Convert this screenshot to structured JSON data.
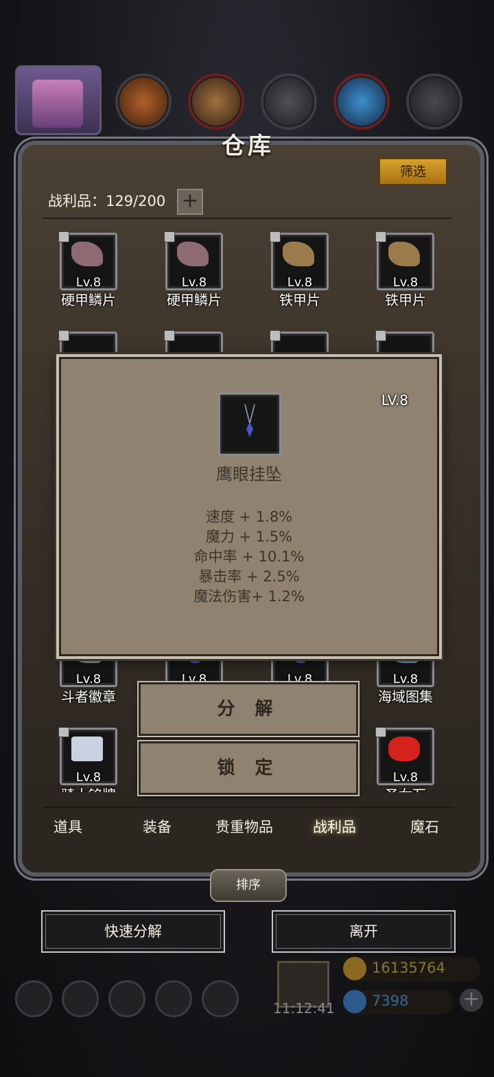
{
  "panel": {
    "title": "仓库",
    "filter_label": "筛选",
    "capacity_label": "战利品：129/200",
    "capacity_plus": "+"
  },
  "items": [
    {
      "lv": "Lv.8",
      "name": "硬甲鳞片",
      "icon": "scale-icon",
      "color": "#8e6b73"
    },
    {
      "lv": "Lv.8",
      "name": "硬甲鳞片",
      "icon": "scale-icon",
      "color": "#8e6b73"
    },
    {
      "lv": "Lv.8",
      "name": "铁甲片",
      "icon": "armor-plate-icon",
      "color": "#9a7b4c"
    },
    {
      "lv": "Lv.8",
      "name": "铁甲片",
      "icon": "armor-plate-icon",
      "color": "#9a7b4c"
    },
    {
      "lv": "Lv.8",
      "name": "斗者徽章",
      "icon": "badge-icon",
      "color": "#8fa3b8"
    },
    {
      "lv": "Lv.8",
      "name": "",
      "icon": "pendant-icon",
      "color": "#4a53c9"
    },
    {
      "lv": "Lv.8",
      "name": "",
      "icon": "pendant-icon",
      "color": "#4a53c9"
    },
    {
      "lv": "Lv.8",
      "name": "海域图集",
      "icon": "map-icon",
      "color": "#6fa4c4"
    },
    {
      "lv": "Lv.8",
      "name": "骑士铭牌",
      "icon": "knight-emblem-icon",
      "color": "#c9d2e0"
    },
    {
      "lv": "Lv.8",
      "name": "圣女石",
      "icon": "red-gem-icon",
      "color": "#d6221c"
    }
  ],
  "tabs": [
    "道具",
    "装备",
    "贵重物品",
    "战利品",
    "魔石"
  ],
  "active_tab": "战利品",
  "sort_label": "排序",
  "quick_decompose_label": "快速分解",
  "leave_label": "离开",
  "hud": {
    "time": "11:12:41",
    "gold": "16135764",
    "gems": "7398",
    "plus": "+"
  },
  "popup": {
    "lv": "LV.8",
    "name": "鹰眼挂坠",
    "stats": [
      "速度 + 1.8%",
      "魔力 + 1.5%",
      "命中率 + 10.1%",
      "暴击率 + 2.5%",
      "魔法伤害+ 1.2%"
    ],
    "decompose_label": "分 解",
    "lock_label": "锁 定"
  },
  "colors": {
    "accent_gold": "#d7a22c",
    "panel_bg": "#3e352b",
    "popup_bg": "#8f8270"
  }
}
